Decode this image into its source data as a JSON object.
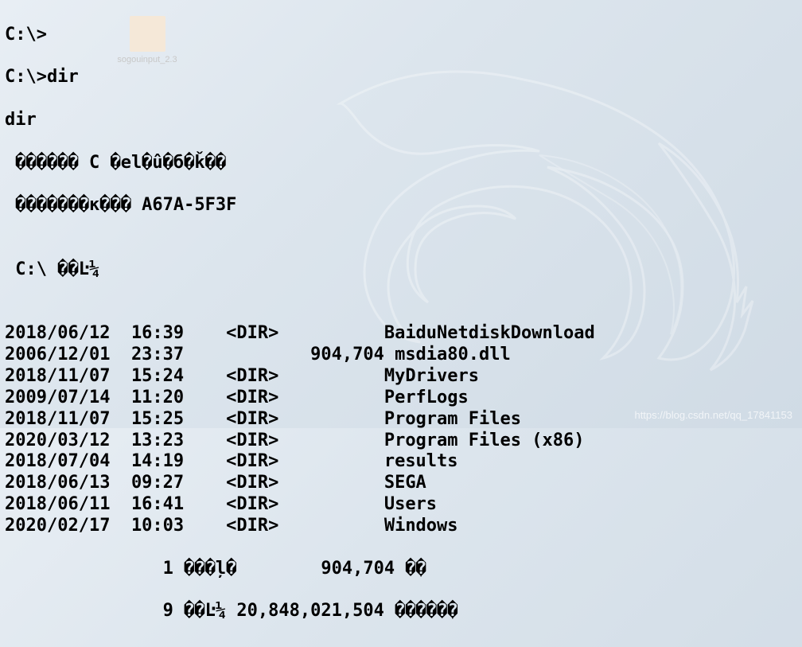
{
  "desktop": {
    "icon_label": "sogouinput_2.3"
  },
  "terminal": {
    "prompt1": "C:\\>",
    "prompt2": "C:\\>dir",
    "echo": "dir",
    "vol_line": " ������ C �el�û�б�ǩ��",
    "serial_line": " �������к��� A67A-5F3F",
    "blank1": "",
    "path_line": " C:\\ ��Ŀ¼",
    "blank2": "",
    "rows": [
      {
        "date": "2018/06/12",
        "time": "16:39",
        "type": "<DIR>",
        "size": "",
        "name": "BaiduNetdiskDownload"
      },
      {
        "date": "2006/12/01",
        "time": "23:37",
        "type": "",
        "size": "904,704",
        "name": "msdia80.dll"
      },
      {
        "date": "2018/11/07",
        "time": "15:24",
        "type": "<DIR>",
        "size": "",
        "name": "MyDrivers"
      },
      {
        "date": "2009/07/14",
        "time": "11:20",
        "type": "<DIR>",
        "size": "",
        "name": "PerfLogs"
      },
      {
        "date": "2018/11/07",
        "time": "15:25",
        "type": "<DIR>",
        "size": "",
        "name": "Program Files"
      },
      {
        "date": "2020/03/12",
        "time": "13:23",
        "type": "<DIR>",
        "size": "",
        "name": "Program Files (x86)"
      },
      {
        "date": "2018/07/04",
        "time": "14:19",
        "type": "<DIR>",
        "size": "",
        "name": "results"
      },
      {
        "date": "2018/06/13",
        "time": "09:27",
        "type": "<DIR>",
        "size": "",
        "name": "SEGA"
      },
      {
        "date": "2018/06/11",
        "time": "16:41",
        "type": "<DIR>",
        "size": "",
        "name": "Users"
      },
      {
        "date": "2020/02/17",
        "time": "10:03",
        "type": "<DIR>",
        "size": "",
        "name": "Windows"
      }
    ],
    "summary1": "               1 ���ļ�        904,704 �ֽ�",
    "summary2": "               9 ��Ŀ¼ 20,848,021,504 �����ֽ�"
  },
  "watermark": "https://blog.csdn.net/qq_17841153"
}
